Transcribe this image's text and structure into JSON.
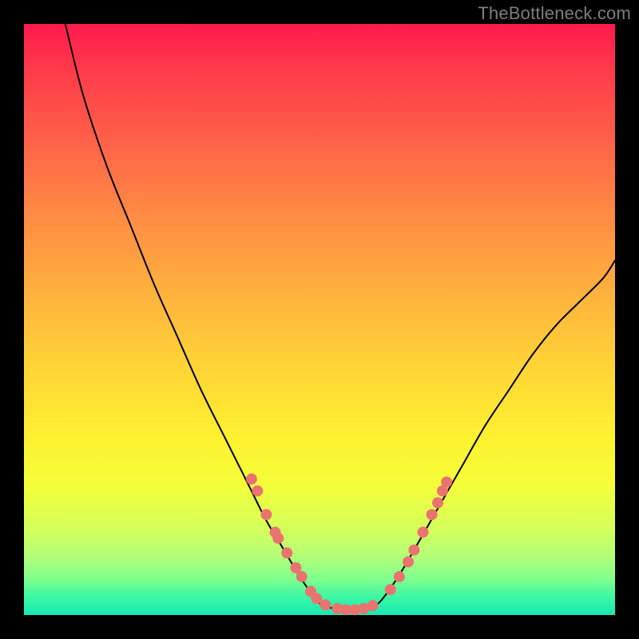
{
  "watermark": "TheBottleneck.com",
  "colors": {
    "frame": "#000000",
    "curve_stroke": "#000000",
    "marker_fill": "#e9746f",
    "marker_stroke": "#e9746f"
  },
  "chart_data": {
    "type": "line",
    "title": "",
    "xlabel": "",
    "ylabel": "",
    "xlim": [
      0,
      100
    ],
    "ylim": [
      0,
      100
    ],
    "grid": false,
    "legend": false,
    "series": [
      {
        "name": "left-branch",
        "x": [
          7,
          10,
          14,
          18,
          22,
          26,
          30,
          34,
          38,
          41,
          44,
          47,
          50
        ],
        "y": [
          100,
          88,
          76,
          66,
          56,
          47,
          38,
          30,
          22,
          16,
          11,
          6,
          2
        ]
      },
      {
        "name": "valley-floor",
        "x": [
          50,
          52,
          54,
          56,
          58,
          60
        ],
        "y": [
          2,
          1.2,
          0.9,
          0.9,
          1.3,
          2
        ]
      },
      {
        "name": "right-branch",
        "x": [
          60,
          63,
          66,
          70,
          74,
          78,
          82,
          86,
          90,
          94,
          98,
          100
        ],
        "y": [
          2,
          6,
          11,
          18,
          25,
          32,
          38,
          44,
          49,
          53,
          57,
          60
        ]
      }
    ],
    "markers": {
      "name": "highlighted-points",
      "points": [
        {
          "x": 38.5,
          "y": 23
        },
        {
          "x": 39.5,
          "y": 21
        },
        {
          "x": 41,
          "y": 17
        },
        {
          "x": 42.5,
          "y": 14
        },
        {
          "x": 43,
          "y": 13
        },
        {
          "x": 44.5,
          "y": 10.5
        },
        {
          "x": 46,
          "y": 8
        },
        {
          "x": 47,
          "y": 6.5
        },
        {
          "x": 48.5,
          "y": 4
        },
        {
          "x": 49.5,
          "y": 2.8
        },
        {
          "x": 51,
          "y": 1.7
        },
        {
          "x": 53,
          "y": 1.1
        },
        {
          "x": 54.5,
          "y": 0.9
        },
        {
          "x": 56,
          "y": 0.9
        },
        {
          "x": 57.5,
          "y": 1.1
        },
        {
          "x": 59,
          "y": 1.6
        },
        {
          "x": 62,
          "y": 4.3
        },
        {
          "x": 63.5,
          "y": 6.5
        },
        {
          "x": 65,
          "y": 9
        },
        {
          "x": 66,
          "y": 11
        },
        {
          "x": 67.5,
          "y": 14
        },
        {
          "x": 69,
          "y": 17
        },
        {
          "x": 70,
          "y": 19
        },
        {
          "x": 70.8,
          "y": 21
        },
        {
          "x": 71.5,
          "y": 22.5
        }
      ]
    }
  }
}
